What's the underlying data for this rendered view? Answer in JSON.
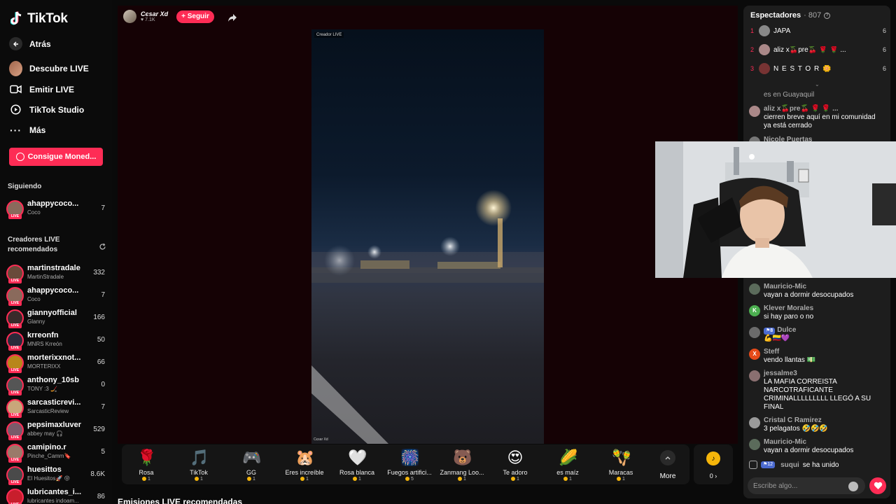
{
  "app": {
    "logo_text": "TikTok"
  },
  "sidebar": {
    "back_label": "Atrás",
    "nav": [
      {
        "label": "Descubre LIVE",
        "icon": "avatar-icon"
      },
      {
        "label": "Emitir LIVE",
        "icon": "camera-icon"
      },
      {
        "label": "TikTok Studio",
        "icon": "studio-icon"
      },
      {
        "label": "Más",
        "icon": "more-dots-icon"
      }
    ],
    "coins_button": "Consigue Moned...",
    "following_label": "Siguiendo",
    "following": [
      {
        "name": "ahappycoco...",
        "sub": "Coco",
        "count": "7"
      }
    ],
    "recommended_label": "Creadores LIVE recomendados",
    "live_tag": "LIVE",
    "recommended": [
      {
        "name": "martinstradale",
        "sub": "MartinStradale",
        "count": "332"
      },
      {
        "name": "ahappycoco...",
        "sub": "Coco",
        "count": "7"
      },
      {
        "name": "giannyofficial",
        "sub": "Glanny",
        "count": "166"
      },
      {
        "name": "krreonfn",
        "sub": "MNRS Krreón",
        "count": "50"
      },
      {
        "name": "morterixxnot...",
        "sub": "MORTERIXX",
        "count": "66"
      },
      {
        "name": "anthony_10sb",
        "sub": "TONY :3 🏒",
        "count": "0"
      },
      {
        "name": "sarcasticrevi...",
        "sub": "SarcasticReview",
        "count": "7"
      },
      {
        "name": "pepsimaxluver",
        "sub": "abbey may 🎧",
        "count": "529"
      },
      {
        "name": "camipino.r",
        "sub": "Pinche_Camm🔖",
        "count": "5"
      },
      {
        "name": "huesittos",
        "sub": "El Huesitos🚀 😝",
        "count": "8.6K"
      },
      {
        "name": "lubricantes_i...",
        "sub": "lubricantes indoam...",
        "count": "86"
      }
    ]
  },
  "stream": {
    "host_name": "Cєsar Xd",
    "host_likes": "7.1K",
    "follow_label": "+ Seguir",
    "video_tag": "Creador LIVE",
    "video_footer": "Cєsar Xd"
  },
  "gifts": [
    {
      "name": "Rosa",
      "price": "1",
      "icon": "🌹"
    },
    {
      "name": "TikTok",
      "price": "1",
      "icon": "🎵"
    },
    {
      "name": "GG",
      "price": "1",
      "icon": "🎮"
    },
    {
      "name": "Eres increíble",
      "price": "1",
      "icon": "🐹"
    },
    {
      "name": "Rosa blanca",
      "price": "1",
      "icon": "🤍"
    },
    {
      "name": "Fuegos artifici...",
      "price": "5",
      "icon": "🎆"
    },
    {
      "name": "Zanmang Loo...",
      "price": "1",
      "icon": "🐻"
    },
    {
      "name": "Te adoro",
      "price": "1",
      "icon": "😍"
    },
    {
      "name": "es maíz",
      "price": "1",
      "icon": "🌽"
    },
    {
      "name": "Maracas",
      "price": "1",
      "icon": "🪇"
    }
  ],
  "more_label": "More",
  "wallet": {
    "value": "0 ›"
  },
  "recommended_streams_title": "Emisiones LIVE recomendadas",
  "viewers": {
    "title": "Espectadores",
    "count": "807",
    "top": [
      {
        "rank": "1",
        "name": "JAPA",
        "count": "6"
      },
      {
        "rank": "2",
        "name": "aliz x🍒pre🍒 🌹 🌹 ...",
        "count": "6"
      },
      {
        "rank": "3",
        "name": "N E S T O R 🌼",
        "count": "6"
      }
    ]
  },
  "chat": {
    "messages_top": [
      {
        "user": "",
        "text": "es en Guayaquil"
      },
      {
        "user": "aliz x🍒pre🍒 🌹 🌹 ...",
        "text": "cierren breve aquí en mi comunidad ya está cerrado"
      },
      {
        "user": "Nicole Puertas",
        "text": ""
      }
    ],
    "messages": [
      {
        "user": "Mauricio-Mic",
        "initial": "",
        "level": "",
        "text": "vayan a dormir desocupados",
        "av_color": "#5b6b5b"
      },
      {
        "user": "Klever Morales",
        "initial": "K",
        "level": "",
        "text": "si hay paro o no",
        "av_color": "#4caf50"
      },
      {
        "user": "Dulce",
        "initial": "",
        "level": "8",
        "text": "💪🇨🇴💜",
        "av_color": "#6b6b6b"
      },
      {
        "user": "Steff",
        "initial": "X",
        "level": "",
        "text": "vendo llantas 💵",
        "av_color": "#e64a19"
      },
      {
        "user": "jessalme3",
        "initial": "",
        "level": "",
        "text": "LA MAFIA CORREISTA NARCOTRAFICANTE CRIMINALLLLLLLLL LLEGÓ A SU FINAL",
        "av_color": "#8a6f70"
      },
      {
        "user": "Cristal C Ramirez",
        "initial": "",
        "level": "",
        "text": "3 pelagatos 🤣🤣🤣",
        "av_color": "#9a9a9a"
      },
      {
        "user": "Mauricio-Mic",
        "initial": "",
        "level": "",
        "text": "vayan a dormir desocupados",
        "av_color": "#5b6b5b"
      }
    ],
    "join": {
      "level": "12",
      "user": "suqui",
      "text": "se ha unido"
    },
    "input_placeholder": "Escribe algo..."
  },
  "colors": {
    "accent": "#fe2c55",
    "coin": "#f5b50a"
  }
}
